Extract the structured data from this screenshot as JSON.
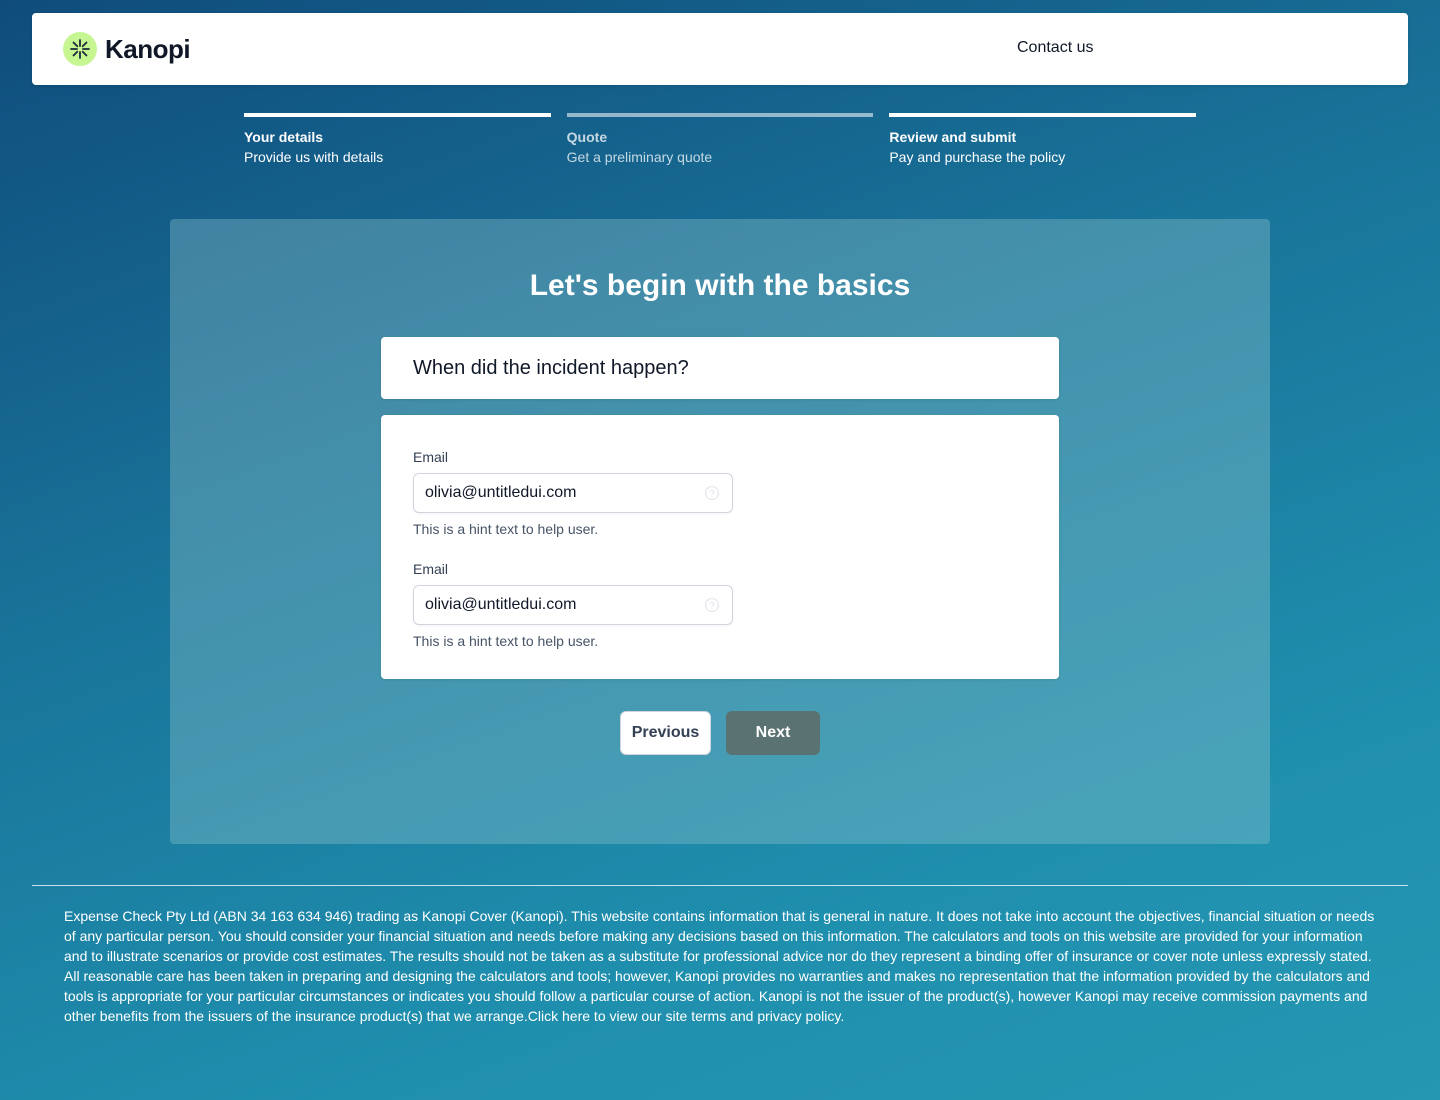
{
  "header": {
    "brand_name": "Kanopi",
    "contact_label": "Contact us"
  },
  "steps": [
    {
      "title": "Your details",
      "subtitle": "Provide us with details",
      "state": "active"
    },
    {
      "title": "Quote",
      "subtitle": "Get a preliminary quote",
      "state": "inactive"
    },
    {
      "title": "Review and submit",
      "subtitle": "Pay and purchase the policy",
      "state": "active"
    }
  ],
  "main": {
    "title": "Let's begin with the basics",
    "question": "When did the incident happen?",
    "fields": [
      {
        "label": "Email",
        "value": "olivia@untitledui.com",
        "hint": "This is a hint text to help user.",
        "icon": "help-circle-icon"
      },
      {
        "label": "Email",
        "value": "olivia@untitledui.com",
        "hint": "This is a hint text to help user.",
        "icon": "help-circle-icon"
      }
    ],
    "previous_label": "Previous",
    "next_label": "Next"
  },
  "footer": {
    "disclaimer": "Expense Check Pty Ltd (ABN 34 163 634 946) trading as Kanopi Cover (Kanopi). This website contains information that is general in nature. It does not take into account the objectives, financial situation or needs of any particular person. You should consider your financial situation and needs before making any decisions based on this information. The calculators and tools on this website are provided for your information and to illustrate scenarios or provide cost estimates. The results should not be taken as a substitute for professional advice nor do they represent a binding offer of insurance or cover note unless expressly stated. All reasonable care has been taken in preparing and designing the calculators and tools; however, Kanopi provides no warranties and makes no representation that the information provided by the calculators and tools is appropriate for your particular circumstances or indicates you should follow a particular course of action. Kanopi is not the issuer of the product(s), however Kanopi may receive commission payments and other benefits from the issuers of the insurance product(s) that we arrange.",
    "terms_link": "Click here to view our site terms and privacy policy."
  },
  "colors": {
    "logo_badge": "#c6f691",
    "next_button": "#5a7271",
    "panel_overlay": "#96c8cd"
  }
}
